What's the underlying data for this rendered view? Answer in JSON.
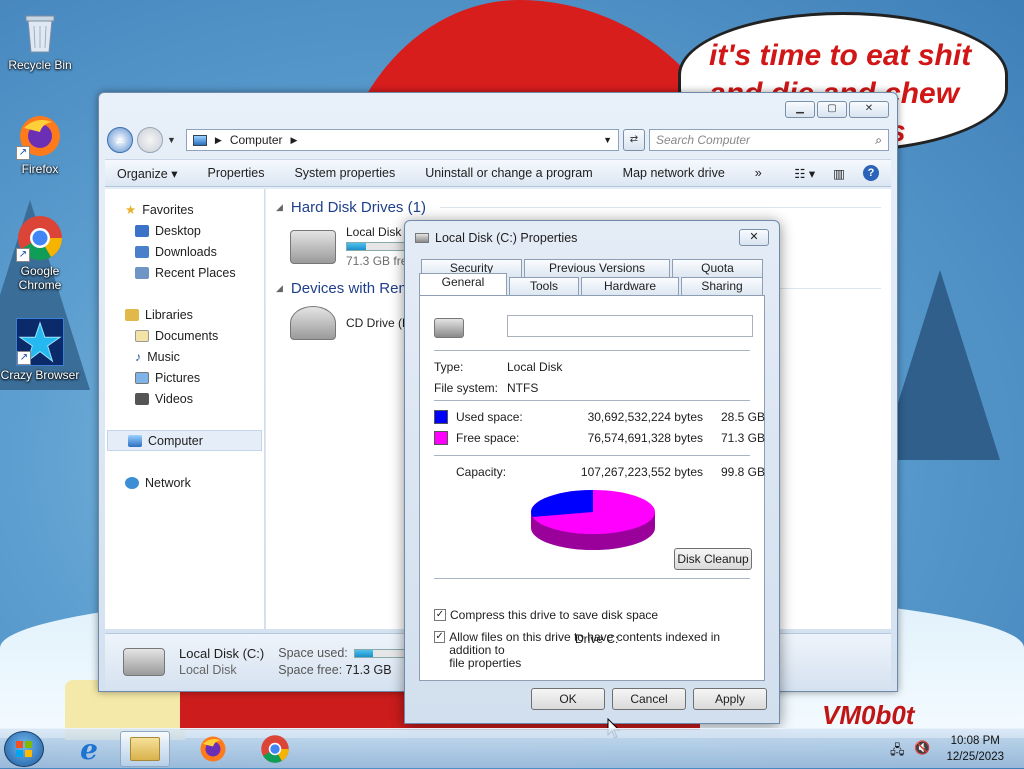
{
  "wallpaper": {
    "bubble_line1": "it's time to eat shit",
    "bubble_line2": "and die and chew",
    "bubble_line3": "s",
    "signature": "VM0b0t"
  },
  "desktop_icons": [
    {
      "label": "Recycle Bin"
    },
    {
      "label": "Firefox"
    },
    {
      "label": "Google Chrome"
    },
    {
      "label": "Crazy Browser"
    }
  ],
  "explorer": {
    "address": "Computer",
    "search_placeholder": "Search Computer",
    "toolbar": {
      "organize": "Organize",
      "properties": "Properties",
      "system_properties": "System properties",
      "uninstall": "Uninstall or change a program",
      "map_network_drive": "Map network drive",
      "overflow": "»"
    },
    "nav": {
      "favorites": "Favorites",
      "desktop": "Desktop",
      "downloads": "Downloads",
      "recent_places": "Recent Places",
      "libraries": "Libraries",
      "documents": "Documents",
      "music": "Music",
      "pictures": "Pictures",
      "videos": "Videos",
      "computer": "Computer",
      "network": "Network"
    },
    "groups": {
      "hdd_header": "Hard Disk Drives (1)",
      "removable_header": "Devices with Rem"
    },
    "drives": {
      "c_name": "Local Disk (C",
      "c_free": "71.3 GB free",
      "c_used_fraction": 0.286,
      "d_name": "CD Drive (D:)"
    },
    "details": {
      "name": "Local Disk (C:)",
      "type": "Local Disk",
      "space_used_label": "Space used:",
      "space_free_label": "Space free:",
      "space_free_value": "71.3 GB",
      "used_fraction": 0.286
    }
  },
  "dialog": {
    "title": "Local Disk (C:) Properties",
    "close": "✕",
    "tabs": {
      "security": "Security",
      "previous_versions": "Previous Versions",
      "quota": "Quota",
      "general": "General",
      "tools": "Tools",
      "hardware": "Hardware",
      "sharing": "Sharing"
    },
    "label_value": "",
    "type_label": "Type:",
    "type_value": "Local Disk",
    "fs_label": "File system:",
    "fs_value": "NTFS",
    "used_label": "Used space:",
    "used_bytes": "30,692,532,224 bytes",
    "used_gb": "28.5 GB",
    "free_label": "Free space:",
    "free_bytes": "76,574,691,328 bytes",
    "free_gb": "71.3 GB",
    "capacity_label": "Capacity:",
    "capacity_bytes": "107,267,223,552 bytes",
    "capacity_gb": "99.8 GB",
    "drive_label": "Drive C:",
    "disk_cleanup": "Disk Cleanup",
    "compress_label": "Compress this drive to save disk space",
    "index_label_1": "Allow files on this drive to have contents indexed in addition to",
    "index_label_2": "file properties",
    "ok": "OK",
    "cancel": "Cancel",
    "apply": "Apply",
    "colors": {
      "used": "#0000ff",
      "free": "#ff00ff"
    }
  },
  "taskbar": {
    "time": "10:08 PM",
    "date": "12/25/2023"
  }
}
